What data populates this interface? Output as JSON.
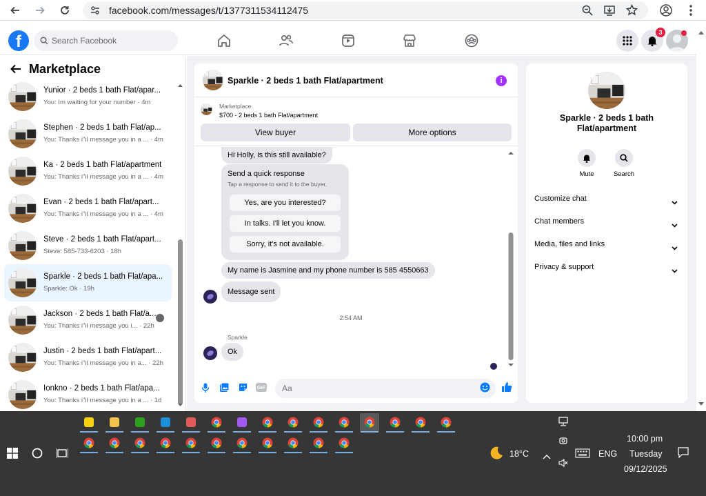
{
  "browser": {
    "url": "facebook.com/messages/t/1377311534112475"
  },
  "header": {
    "search_placeholder": "Search Facebook",
    "notification_count": "3"
  },
  "sidebar": {
    "title": "Marketplace",
    "conversations": [
      {
        "name": "Yunior · 2 beds 1 bath Flat/apar...",
        "snippet": "You: Im waiting for your number · 4m"
      },
      {
        "name": "Stephen · 2 beds 1 bath Flat/ap...",
        "snippet": "You: Thanks i\"il message you in a ... · 4m"
      },
      {
        "name": "Ka · 2 beds 1 bath Flat/apartment",
        "snippet": "You: Thanks i\"il message you in a ... · 4m"
      },
      {
        "name": "Evan · 2 beds 1 bath Flat/apart...",
        "snippet": "You: Thanks i\"il message you in a ... · 4m"
      },
      {
        "name": "Steve · 2 beds 1 bath Flat/apart...",
        "snippet": "Steve: 585-733-6203 · 18h"
      },
      {
        "name": "Sparkle · 2 beds 1 bath Flat/apa...",
        "snippet": "Sparkle: Ok · 19h"
      },
      {
        "name": "Jackson · 2 beds 1 bath Flat/a...",
        "snippet": "You: Thanks i\"il message you i... · 22h"
      },
      {
        "name": "Justin · 2 beds 1 bath Flat/apart...",
        "snippet": "You: Thanks i\"il message you in a... · 22h"
      },
      {
        "name": "Ionkno · 2 beds 1 bath Flat/apa...",
        "snippet": "You: Thanks i\"il message you in a ... · 1d"
      }
    ]
  },
  "chat": {
    "title": "Sparkle · 2 beds 1 bath Flat/apartment",
    "card": {
      "label": "Marketplace",
      "listing": "$700 - 2 beds 1 bath Flat/apartment",
      "view_buyer": "View buyer",
      "more_options": "More options"
    },
    "messages": {
      "first": "Hi Holly, is this still available?",
      "quick_title": "Send a quick response",
      "quick_sub": "Tap a response to send it to the buyer.",
      "quick_1": "Yes, are you interested?",
      "quick_2": "In talks. I'll let you know.",
      "quick_3": "Sorry, it's not available.",
      "phone_msg": "My name is Jasmine and my phone number is 585 4550663",
      "sent": "Message sent",
      "time": "2:54 AM",
      "sender": "Sparkle",
      "reply": "Ok"
    },
    "composer": {
      "placeholder": "Aa",
      "gif": "GIF"
    }
  },
  "details": {
    "title": "Sparkle · 2 beds 1 bath Flat/apartment",
    "mute": "Mute",
    "search": "Search",
    "sections": [
      "Customize chat",
      "Chat members",
      "Media, files and links",
      "Privacy & support"
    ]
  },
  "taskbar": {
    "weather": "18°C",
    "lang": "ENG",
    "time": "10:00 pm",
    "day": "Tuesday",
    "date": "09/12/2025"
  },
  "colors": {
    "facebook_blue": "#1877f2",
    "messenger_blue": "#0a7cff",
    "info_purple": "#a033ff",
    "taskbar": "#363636"
  }
}
